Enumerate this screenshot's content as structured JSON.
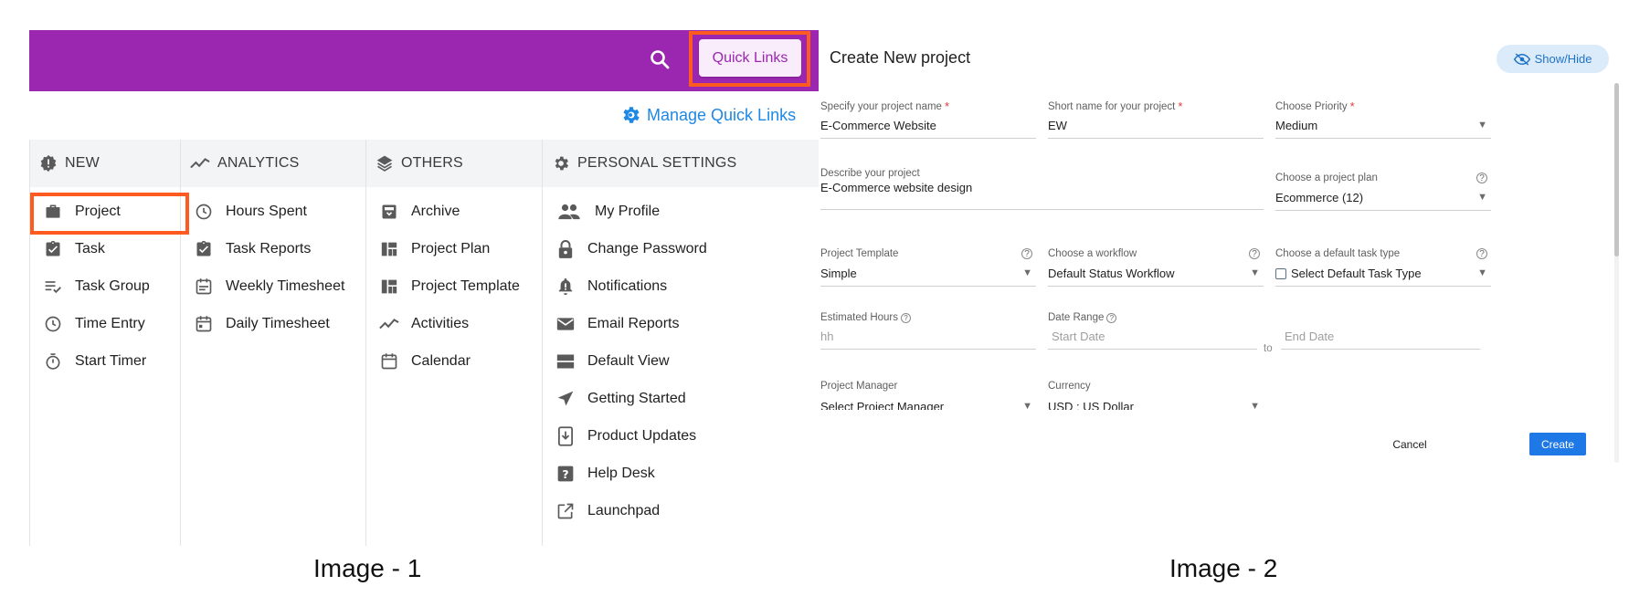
{
  "image1": {
    "search_icon": "search-icon",
    "quick_links_label": "Quick Links",
    "manage_quick_links_label": "Manage Quick Links",
    "columns": [
      {
        "header": "NEW",
        "header_icon": "new-badge-icon",
        "items": [
          {
            "label": "Project",
            "icon": "briefcase-icon"
          },
          {
            "label": "Task",
            "icon": "clipboard-check-icon"
          },
          {
            "label": "Task Group",
            "icon": "checklist-icon"
          },
          {
            "label": "Time Entry",
            "icon": "clock-icon"
          },
          {
            "label": "Start Timer",
            "icon": "stopwatch-icon"
          }
        ]
      },
      {
        "header": "ANALYTICS",
        "header_icon": "trend-line-icon",
        "items": [
          {
            "label": "Hours Spent",
            "icon": "clock-icon"
          },
          {
            "label": "Task Reports",
            "icon": "clipboard-check-icon"
          },
          {
            "label": "Weekly Timesheet",
            "icon": "calendar-week-icon"
          },
          {
            "label": "Daily Timesheet",
            "icon": "calendar-day-icon"
          }
        ]
      },
      {
        "header": "OTHERS",
        "header_icon": "layers-icon",
        "items": [
          {
            "label": "Archive",
            "icon": "archive-icon"
          },
          {
            "label": "Project Plan",
            "icon": "dashboard-icon"
          },
          {
            "label": "Project Template",
            "icon": "dashboard-icon"
          },
          {
            "label": "Activities",
            "icon": "trend-line-icon"
          },
          {
            "label": "Calendar",
            "icon": "calendar-icon"
          }
        ]
      },
      {
        "header": "PERSONAL SETTINGS",
        "header_icon": "gear-icon",
        "items": [
          {
            "label": "My Profile",
            "icon": "people-icon"
          },
          {
            "label": "Change Password",
            "icon": "lock-icon"
          },
          {
            "label": "Notifications",
            "icon": "bell-icon"
          },
          {
            "label": "Email Reports",
            "icon": "mail-icon"
          },
          {
            "label": "Default View",
            "icon": "view-stream-icon"
          },
          {
            "label": "Getting Started",
            "icon": "navigation-arrow-icon"
          },
          {
            "label": "Product Updates",
            "icon": "system-update-icon"
          },
          {
            "label": "Help Desk",
            "icon": "help-box-icon"
          },
          {
            "label": "Launchpad",
            "icon": "open-external-icon"
          }
        ]
      }
    ],
    "accent_color": "#9b27b0",
    "highlight_color": "#ff5a1f"
  },
  "image2": {
    "title": "Create New project",
    "show_hide_label": "Show/Hide",
    "fields": {
      "project_name": {
        "label": "Specify your project name",
        "value": "E-Commerce Website"
      },
      "short_name": {
        "label": "Short name for your project",
        "value": "EW"
      },
      "priority": {
        "label": "Choose Priority",
        "value": "Medium"
      },
      "description": {
        "label": "Describe your project",
        "value": "E-Commerce website design"
      },
      "project_plan": {
        "label": "Choose a project plan",
        "value": "Ecommerce (12)"
      },
      "template": {
        "label": "Project Template",
        "value": "Simple"
      },
      "workflow": {
        "label": "Choose a workflow",
        "value": "Default Status Workflow"
      },
      "task_type": {
        "label": "Choose a default task type",
        "value": "Select Default Task Type"
      },
      "estimated_hours": {
        "label": "Estimated Hours",
        "placeholder": "hh"
      },
      "date_range": {
        "label": "Date Range",
        "start_placeholder": "Start Date",
        "end_placeholder": "End Date",
        "separator": "to"
      },
      "project_manager": {
        "label": "Project Manager",
        "value": "Select Project Manager"
      },
      "currency": {
        "label": "Currency",
        "value": "USD : US Dollar"
      }
    },
    "required_marker": "*",
    "cancel_label": "Cancel",
    "create_label": "Create",
    "button_color": "#1e78e6"
  },
  "captions": {
    "image1": "Image - 1",
    "image2": "Image - 2"
  }
}
